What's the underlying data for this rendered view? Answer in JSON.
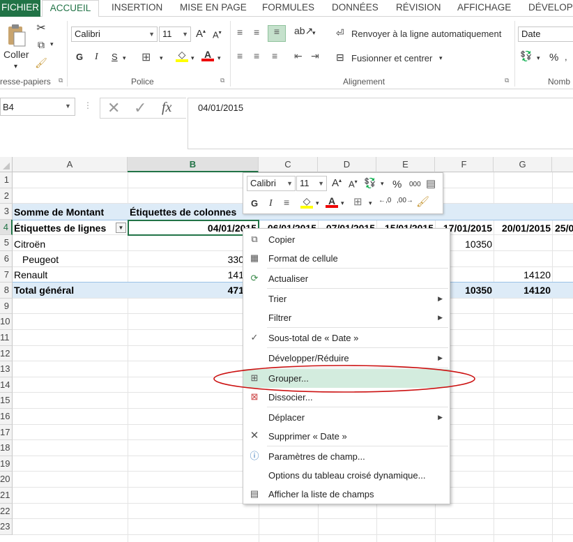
{
  "ribbon": {
    "tabs": [
      "FICHIER",
      "ACCUEIL",
      "INSERTION",
      "MISE EN PAGE",
      "FORMULES",
      "DONNÉES",
      "RÉVISION",
      "AFFICHAGE",
      "DÉVELOPP"
    ],
    "clipboard": {
      "paste_label": "Coller",
      "group_label": "resse-papiers"
    },
    "font": {
      "name": "Calibri",
      "size": "11",
      "group_label": "Police",
      "bold": "G",
      "italic": "I",
      "underline": "S"
    },
    "alignment": {
      "wrap_label": "Renvoyer à la ligne automatiquement",
      "merge_label": "Fusionner et centrer",
      "group_label": "Alignement"
    },
    "number": {
      "format": "Date",
      "group_label": "Nomb",
      "percent": "%"
    }
  },
  "formula_bar": {
    "name_box": "B4",
    "content": "04/01/2015",
    "fx": "fx"
  },
  "grid": {
    "columns": [
      "A",
      "B",
      "C",
      "D",
      "E",
      "F",
      "G"
    ],
    "rows": [
      "1",
      "2",
      "3",
      "4",
      "5",
      "6",
      "7",
      "8",
      "9",
      "10",
      "11",
      "12",
      "13",
      "14",
      "15",
      "16",
      "17",
      "18",
      "19",
      "20",
      "21",
      "22",
      "23"
    ],
    "cells": {
      "a3": "Somme de Montant",
      "b3": "Étiquettes de colonnes",
      "a4": "Étiquettes de lignes",
      "b4": "04/01/2015",
      "c4": "06/01/2015",
      "d4": "07/01/2015",
      "e4": "15/01/2015",
      "f4": "17/01/2015",
      "g4": "20/01/2015",
      "h4": "25/0",
      "a5": "Citroën",
      "f5": "10350",
      "a6": "Peugeot",
      "b6": "330",
      "a7": "Renault",
      "b7": "141",
      "g7": "14120",
      "a8": "Total général",
      "b8": "471",
      "f8": "10350",
      "g8": "14120"
    }
  },
  "mini_toolbar": {
    "font": "Calibri",
    "size": "11",
    "bold": "G",
    "italic": "I",
    "percent": "%",
    "thousands": "000"
  },
  "context_menu": {
    "items": [
      {
        "label": "Copier"
      },
      {
        "label": "Format de cellule"
      },
      {
        "label": "Actualiser"
      },
      {
        "label": "Trier"
      },
      {
        "label": "Filtrer"
      },
      {
        "label": "Sous-total de « Date »"
      },
      {
        "label": "Développer/Réduire"
      },
      {
        "label": "Grouper..."
      },
      {
        "label": "Dissocier..."
      },
      {
        "label": "Déplacer"
      },
      {
        "label": "Supprimer « Date »"
      },
      {
        "label": "Paramètres de champ..."
      },
      {
        "label": "Options du tableau croisé dynamique..."
      },
      {
        "label": "Afficher la liste de champs"
      }
    ]
  },
  "colors": {
    "excel_green": "#217346",
    "highlight": "#d3ecde",
    "pivot_header": "#ddebf7",
    "annotation_red": "#cc1111"
  }
}
